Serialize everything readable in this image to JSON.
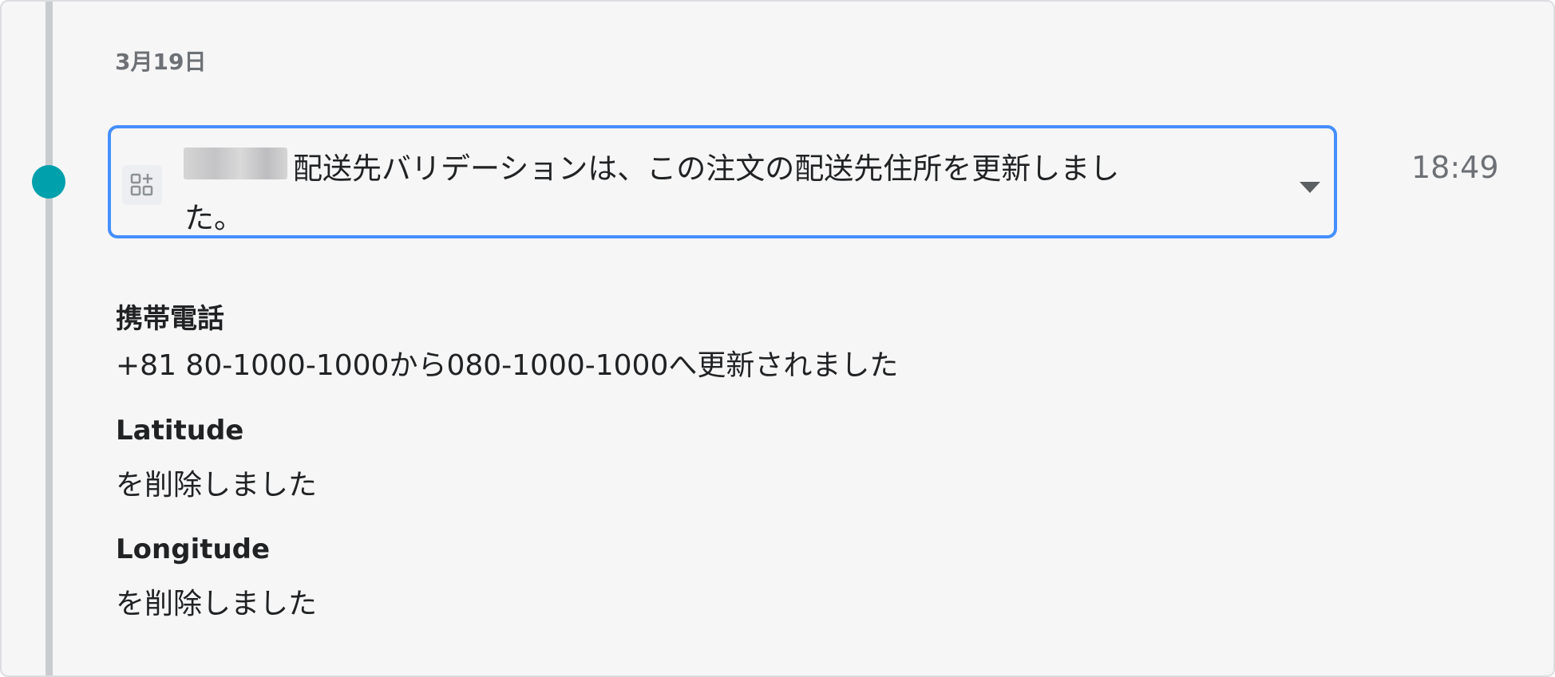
{
  "date_heading": "3月19日",
  "event": {
    "app_icon": "app-add-icon",
    "message": "配送先バリデーションは、この注文の配送先住所を更新しました。",
    "time": "18:49",
    "expand_icon": "caret-down-icon"
  },
  "details": [
    {
      "label": "携帯電話",
      "value": "+81 80-1000-1000から080-1000-1000へ更新されました"
    },
    {
      "label": "Latitude",
      "value": "を削除しました"
    },
    {
      "label": "Longitude",
      "value": "を削除しました"
    }
  ],
  "colors": {
    "timeline_dot": "#00a0ac",
    "card_border": "#458fff",
    "background": "#f6f6f7"
  }
}
